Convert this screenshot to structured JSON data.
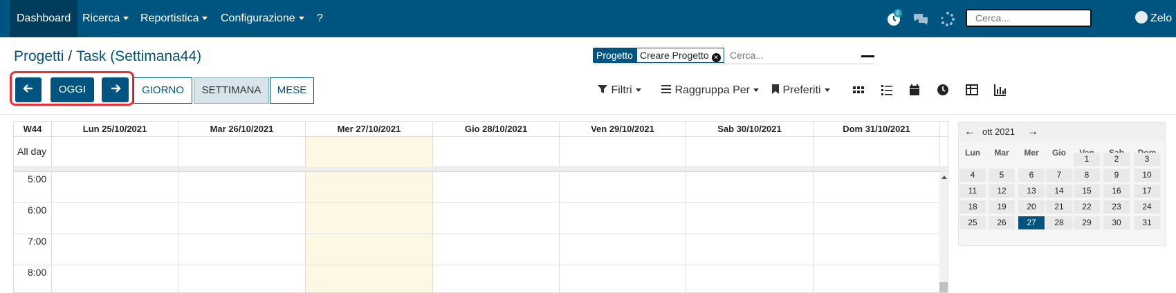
{
  "topbar": {
    "menu": [
      {
        "label": "Dashboard",
        "active": true,
        "dropdown": false
      },
      {
        "label": "Ricerca",
        "active": false,
        "dropdown": true
      },
      {
        "label": "Reportistica",
        "active": false,
        "dropdown": true
      },
      {
        "label": "Configurazione",
        "active": false,
        "dropdown": true
      },
      {
        "label": "?",
        "active": false,
        "dropdown": false
      }
    ],
    "activity_badge": "6",
    "search_placeholder": "Cerca...",
    "user_name": "Zelo",
    "icons": [
      "clock-activity-icon",
      "chat-icon",
      "spinner-icon"
    ]
  },
  "breadcrumb": {
    "root": "Progetti",
    "separator": "/",
    "current": "Task (Settimana44)"
  },
  "search": {
    "facet_label": "Progetto",
    "facet_value": "Creare Progetto",
    "placeholder": "Cerca..."
  },
  "nav_buttons": {
    "prev_icon": "arrow-left-icon",
    "today": "OGGI",
    "next_icon": "arrow-right-icon",
    "day": "GIORNO",
    "week": "SETTIMANA",
    "month": "MESE",
    "active_scale": "week"
  },
  "toolbar": {
    "filters": "Filtri",
    "group_by": "Raggruppa Per",
    "favorites": "Preferiti",
    "views": [
      "kanban-icon",
      "list-icon",
      "calendar-icon",
      "activity-icon",
      "pivot-icon",
      "graph-icon"
    ]
  },
  "calendar": {
    "week_label": "W44",
    "days": [
      "Lun 25/10/2021",
      "Mar 26/10/2021",
      "Mer 27/10/2021",
      "Gio 28/10/2021",
      "Ven 29/10/2021",
      "Sab 30/10/2021",
      "Dom 31/10/2021"
    ],
    "today_index": 2,
    "all_day": "All day",
    "times": [
      "5:00",
      "6:00",
      "7:00",
      "8:00"
    ]
  },
  "mini_calendar": {
    "month": "ott 2021",
    "weekdays": [
      "Lun",
      "Mar",
      "Mer",
      "Gio",
      "Ven",
      "Sab",
      "Dom"
    ],
    "weeks": [
      [
        "",
        "",
        "",
        "",
        "1",
        "2",
        "3"
      ],
      [
        "4",
        "5",
        "6",
        "7",
        "8",
        "9",
        "10"
      ],
      [
        "11",
        "12",
        "13",
        "14",
        "15",
        "16",
        "17"
      ],
      [
        "18",
        "19",
        "20",
        "21",
        "22",
        "23",
        "24"
      ],
      [
        "25",
        "26",
        "27",
        "28",
        "29",
        "30",
        "31"
      ]
    ],
    "selected_day": "27"
  },
  "colors": {
    "brand": "#005580",
    "today_bg": "#fcf8e3",
    "highlight": "#e5323a"
  }
}
